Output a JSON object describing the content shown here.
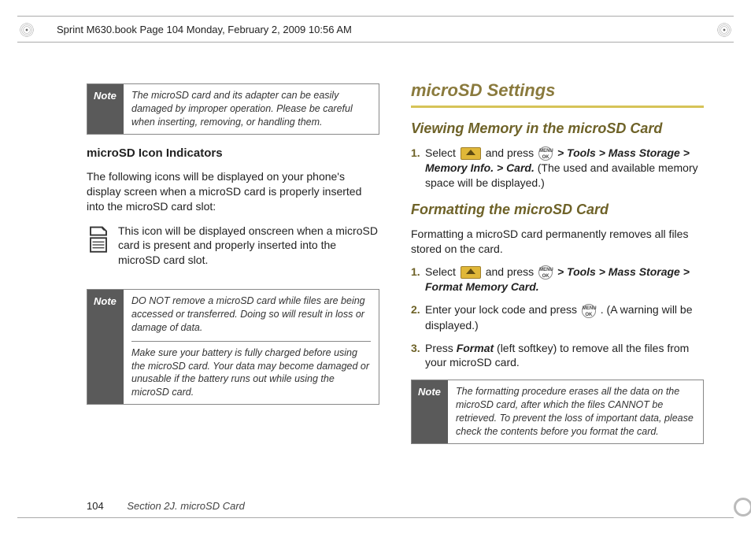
{
  "crop_header": "Sprint M630.book  Page 104  Monday, February 2, 2009  10:56 AM",
  "left": {
    "note1": {
      "label": "Note",
      "body": "The microSD card and its adapter can be easily damaged by improper operation. Please be careful when inserting, removing, or handling them."
    },
    "sub_heading": "microSD Icon Indicators",
    "intro": "The following icons will be displayed on your phone's display screen when a microSD card is properly inserted into the microSD card slot:",
    "icon_desc": "This icon will be displayed onscreen when a microSD card is present and properly inserted into the microSD card slot.",
    "note2": {
      "label": "Note",
      "p1": "DO NOT remove a microSD card while files are being accessed or transferred. Doing so will result in loss or damage of data.",
      "p2": "Make sure your battery is fully charged before using the microSD card. Your data may become damaged or unusable if the battery runs out while using the microSD card."
    }
  },
  "right": {
    "h1": "microSD Settings",
    "h2a": "Viewing Memory in the microSD Card",
    "step_a1_pre": "Select ",
    "step_a1_mid": " and press ",
    "path_a": " > Tools > Mass Storage > Memory Info. > Card.",
    "step_a1_post": " (The used and available memory space will be displayed.)",
    "h2b": "Formatting the microSD Card",
    "format_intro": "Formatting a microSD card permanently removes all files stored on the card.",
    "step_b1_pre": "Select ",
    "step_b1_mid": " and press ",
    "path_b": " > Tools > Mass Storage > Format Memory Card.",
    "step_b2_pre": "Enter your lock code and press ",
    "step_b2_post": ". (A warning will be displayed.)",
    "step_b3_pre": "Press ",
    "step_b3_key": "Format",
    "step_b3_post": " (left softkey) to remove all the files from your microSD card.",
    "note3": {
      "label": "Note",
      "body": "The formatting procedure erases all the data on the microSD card, after which the files CANNOT be retrieved. To prevent the loss of important data, please check the contents before you format the card."
    }
  },
  "footer": {
    "page_num": "104",
    "section": "Section 2J. microSD Card"
  },
  "menu_ok_text": "MENU OK"
}
